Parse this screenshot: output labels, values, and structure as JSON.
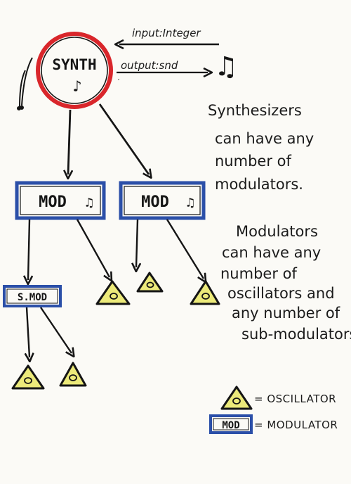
{
  "synth": {
    "label": "SYNTH",
    "note": "♪"
  },
  "io": {
    "input_label": "input:Integer",
    "output_label": "output:snd",
    "output_note": "♫"
  },
  "modulators": [
    {
      "label": "MOD",
      "note": "♫"
    },
    {
      "label": "MOD",
      "note": "♫"
    }
  ],
  "sub_modulator": {
    "label": "S.MOD"
  },
  "notes": {
    "paragraph1": [
      "Synthesizers",
      "can have any",
      "number of",
      "modulators."
    ],
    "paragraph2": [
      "Modulators",
      "can have any",
      "number of",
      "oscillators and",
      "any number of",
      "sub-modulators"
    ]
  },
  "legend": {
    "oscillator_label": "= OSCILLATOR",
    "modulator_box": "MOD",
    "modulator_label": "= MODULATOR"
  },
  "colors": {
    "synth_ring": "#d9262b",
    "mod_border": "#2b4fa8",
    "osc_fill": "#ecea7a",
    "ink": "#151515"
  }
}
